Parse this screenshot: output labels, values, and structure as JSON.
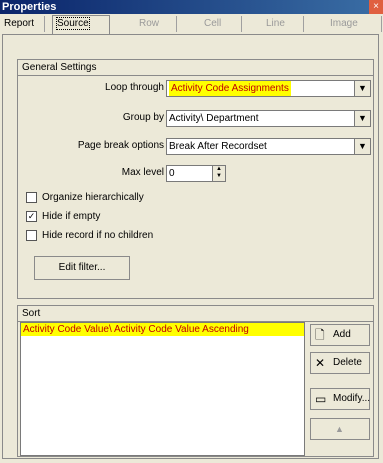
{
  "window": {
    "title": "Properties",
    "close_glyph": "×"
  },
  "tabs": [
    {
      "label": "Report",
      "state": "enabled"
    },
    {
      "label": "Source",
      "state": "active"
    },
    {
      "label": "Row",
      "state": "disabled"
    },
    {
      "label": "Cell",
      "state": "disabled"
    },
    {
      "label": "Line",
      "state": "disabled"
    },
    {
      "label": "Image",
      "state": "disabled"
    }
  ],
  "general": {
    "header": "General Settings",
    "loop_through": {
      "label": "Loop through",
      "value": "Activity Code Assignments"
    },
    "group_by": {
      "label": "Group by",
      "value": "Activity\\ Department"
    },
    "page_break": {
      "label": "Page break options",
      "value": "Break After Recordset"
    },
    "max_level": {
      "label": "Max level",
      "value": "0"
    },
    "organize": {
      "label": "Organize hierarchically",
      "checked": false
    },
    "hide_empty": {
      "label": "Hide if empty",
      "checked": true
    },
    "hide_no_children": {
      "label": "Hide record if no children",
      "checked": false
    },
    "edit_filter_label": "Edit filter..."
  },
  "sort": {
    "header": "Sort",
    "items": [
      "Activity Code Value\\ Activity Code Value Ascending"
    ],
    "add_label": "Add",
    "delete_label": "Delete",
    "modify_label": "Modify..."
  },
  "icons": {
    "add": "page-icon",
    "delete": "x-icon",
    "modify": "modify-icon",
    "move_up": "up-arrow-icon",
    "move_down": "down-arrow-icon"
  },
  "colors": {
    "highlight_bg": "#ffff00",
    "highlight_text": "#c00000",
    "title_bar": "#0a246a"
  }
}
